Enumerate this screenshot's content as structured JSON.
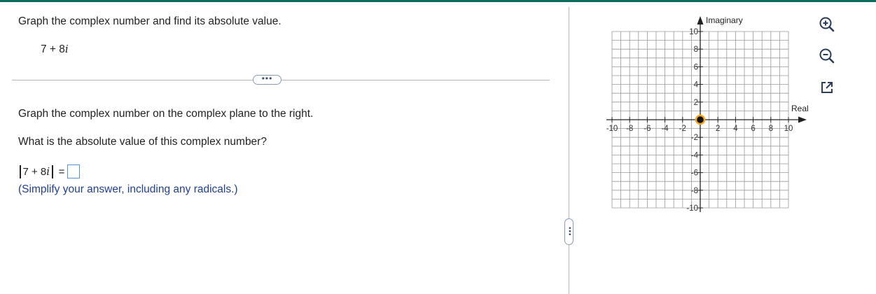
{
  "problem": {
    "title": "Graph the complex number and find its absolute value.",
    "number_real": "7 + 8",
    "number_imag": "i"
  },
  "expand_button": {
    "label": "•••"
  },
  "side_button": {
    "label": "•••"
  },
  "instructions": {
    "graph_text": "Graph the complex number on the complex plane to the right.",
    "question": "What is the absolute value of this complex number?",
    "answer_expr_real": "7 + 8",
    "answer_expr_imag": "i",
    "equals": "=",
    "answer_value": "",
    "hint": "(Simplify your answer, including any radicals.)"
  },
  "graph": {
    "x_axis_label": "Real",
    "y_axis_label": "Imaginary",
    "x_range": [
      -10,
      10
    ],
    "y_range": [
      -10,
      10
    ],
    "x_tick_labels": [
      "-10",
      "-8",
      "-6",
      "-4",
      "-2",
      "2",
      "4",
      "6",
      "8",
      "10"
    ],
    "y_tick_labels": [
      "10",
      "8",
      "6",
      "4",
      "2",
      "-2",
      "-4",
      "-6",
      "-8",
      "-10"
    ],
    "point": {
      "re": 0,
      "im": 0
    },
    "point_color": "#f5a623"
  },
  "toolbar": {
    "zoom_in": "zoom-in-icon",
    "zoom_out": "zoom-out-icon",
    "popout": "popout-icon"
  },
  "colors": {
    "accent_bar": "#0e6a5c",
    "hint_text": "#1f3f8f",
    "grid": "#9a9a9a",
    "answer_border": "#5b8fcf"
  }
}
